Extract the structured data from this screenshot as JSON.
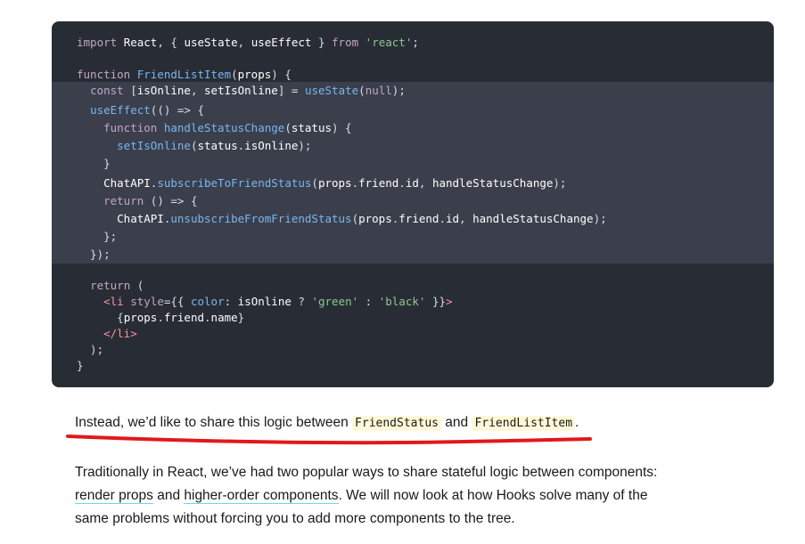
{
  "code": {
    "lines": [
      [
        [
          "kw",
          "import "
        ],
        [
          "id",
          "React"
        ],
        [
          "op",
          ", { "
        ],
        [
          "id",
          "useState"
        ],
        [
          "op",
          ", "
        ],
        [
          "id",
          "useEffect"
        ],
        [
          "op",
          " } "
        ],
        [
          "kw",
          "from "
        ],
        [
          "str",
          "'react'"
        ],
        [
          "op",
          ";"
        ]
      ],
      [],
      [
        [
          "kw",
          "function "
        ],
        [
          "fn",
          "FriendListItem"
        ],
        [
          "op",
          "("
        ],
        [
          "id",
          "props"
        ],
        [
          "op",
          ") {"
        ]
      ],
      [
        [
          "op",
          "  "
        ],
        [
          "kw",
          "const "
        ],
        [
          "op",
          "["
        ],
        [
          "id",
          "isOnline"
        ],
        [
          "op",
          ", "
        ],
        [
          "id",
          "setIsOnline"
        ],
        [
          "op",
          "] = "
        ],
        [
          "fn",
          "useState"
        ],
        [
          "op",
          "("
        ],
        [
          "kw",
          "null"
        ],
        [
          "op",
          ");"
        ]
      ],
      [
        [
          "op",
          "  "
        ],
        [
          "fn",
          "useEffect"
        ],
        [
          "op",
          "(() => {"
        ]
      ],
      [
        [
          "op",
          "    "
        ],
        [
          "kw",
          "function "
        ],
        [
          "fn",
          "handleStatusChange"
        ],
        [
          "op",
          "("
        ],
        [
          "id",
          "status"
        ],
        [
          "op",
          ") {"
        ]
      ],
      [
        [
          "op",
          "      "
        ],
        [
          "fn",
          "setIsOnline"
        ],
        [
          "op",
          "("
        ],
        [
          "id",
          "status"
        ],
        [
          "op",
          "."
        ],
        [
          "id",
          "isOnline"
        ],
        [
          "op",
          ");"
        ]
      ],
      [
        [
          "op",
          "    }"
        ]
      ],
      [
        [
          "op",
          "    "
        ],
        [
          "id",
          "ChatAPI"
        ],
        [
          "op",
          "."
        ],
        [
          "fn",
          "subscribeToFriendStatus"
        ],
        [
          "op",
          "("
        ],
        [
          "id",
          "props"
        ],
        [
          "op",
          "."
        ],
        [
          "id",
          "friend"
        ],
        [
          "op",
          "."
        ],
        [
          "id",
          "id"
        ],
        [
          "op",
          ", "
        ],
        [
          "id",
          "handleStatusChange"
        ],
        [
          "op",
          ");"
        ]
      ],
      [
        [
          "op",
          "    "
        ],
        [
          "kw",
          "return "
        ],
        [
          "op",
          "() => {"
        ]
      ],
      [
        [
          "op",
          "      "
        ],
        [
          "id",
          "ChatAPI"
        ],
        [
          "op",
          "."
        ],
        [
          "fn",
          "unsubscribeFromFriendStatus"
        ],
        [
          "op",
          "("
        ],
        [
          "id",
          "props"
        ],
        [
          "op",
          "."
        ],
        [
          "id",
          "friend"
        ],
        [
          "op",
          "."
        ],
        [
          "id",
          "id"
        ],
        [
          "op",
          ", "
        ],
        [
          "id",
          "handleStatusChange"
        ],
        [
          "op",
          ");"
        ]
      ],
      [
        [
          "op",
          "    };"
        ]
      ],
      [
        [
          "op",
          "  });"
        ]
      ],
      [],
      [
        [
          "op",
          "  "
        ],
        [
          "kw",
          "return "
        ],
        [
          "op",
          "("
        ]
      ],
      [
        [
          "op",
          "    "
        ],
        [
          "tag",
          "<li "
        ],
        [
          "attr",
          "style"
        ],
        [
          "op",
          "={{ "
        ],
        [
          "prop",
          "color"
        ],
        [
          "op",
          ": "
        ],
        [
          "id",
          "isOnline"
        ],
        [
          "op",
          " ? "
        ],
        [
          "str",
          "'green'"
        ],
        [
          "op",
          " : "
        ],
        [
          "str",
          "'black'"
        ],
        [
          "op",
          " }}"
        ],
        [
          "tag",
          ">"
        ]
      ],
      [
        [
          "op",
          "      {"
        ],
        [
          "id",
          "props"
        ],
        [
          "op",
          "."
        ],
        [
          "id",
          "friend"
        ],
        [
          "op",
          "."
        ],
        [
          "id",
          "name"
        ],
        [
          "op",
          "}"
        ]
      ],
      [
        [
          "op",
          "    "
        ],
        [
          "tag",
          "</li>"
        ]
      ],
      [
        [
          "op",
          "  );"
        ]
      ],
      [
        [
          "op",
          "}"
        ]
      ]
    ]
  },
  "para1": {
    "text1": "Instead, we’d like to share this logic between ",
    "code1": "FriendStatus",
    "text2": " and ",
    "code2": "FriendListItem",
    "text3": "."
  },
  "para2": {
    "line1": "Traditionally in React, we’ve had two popular ways to share stateful logic between components:",
    "link1": "render props",
    "and": " and ",
    "link2": "higher-order components",
    "line2_rest": ". We will now look at how Hooks solve many of the",
    "line3": "same problems without forcing you to add more components to the tree."
  },
  "colors": {
    "code_bg": "#282c34",
    "highlight_band": "#3a3f4b",
    "red_underline": "#e0191b",
    "link_underline": "#61dafb"
  }
}
